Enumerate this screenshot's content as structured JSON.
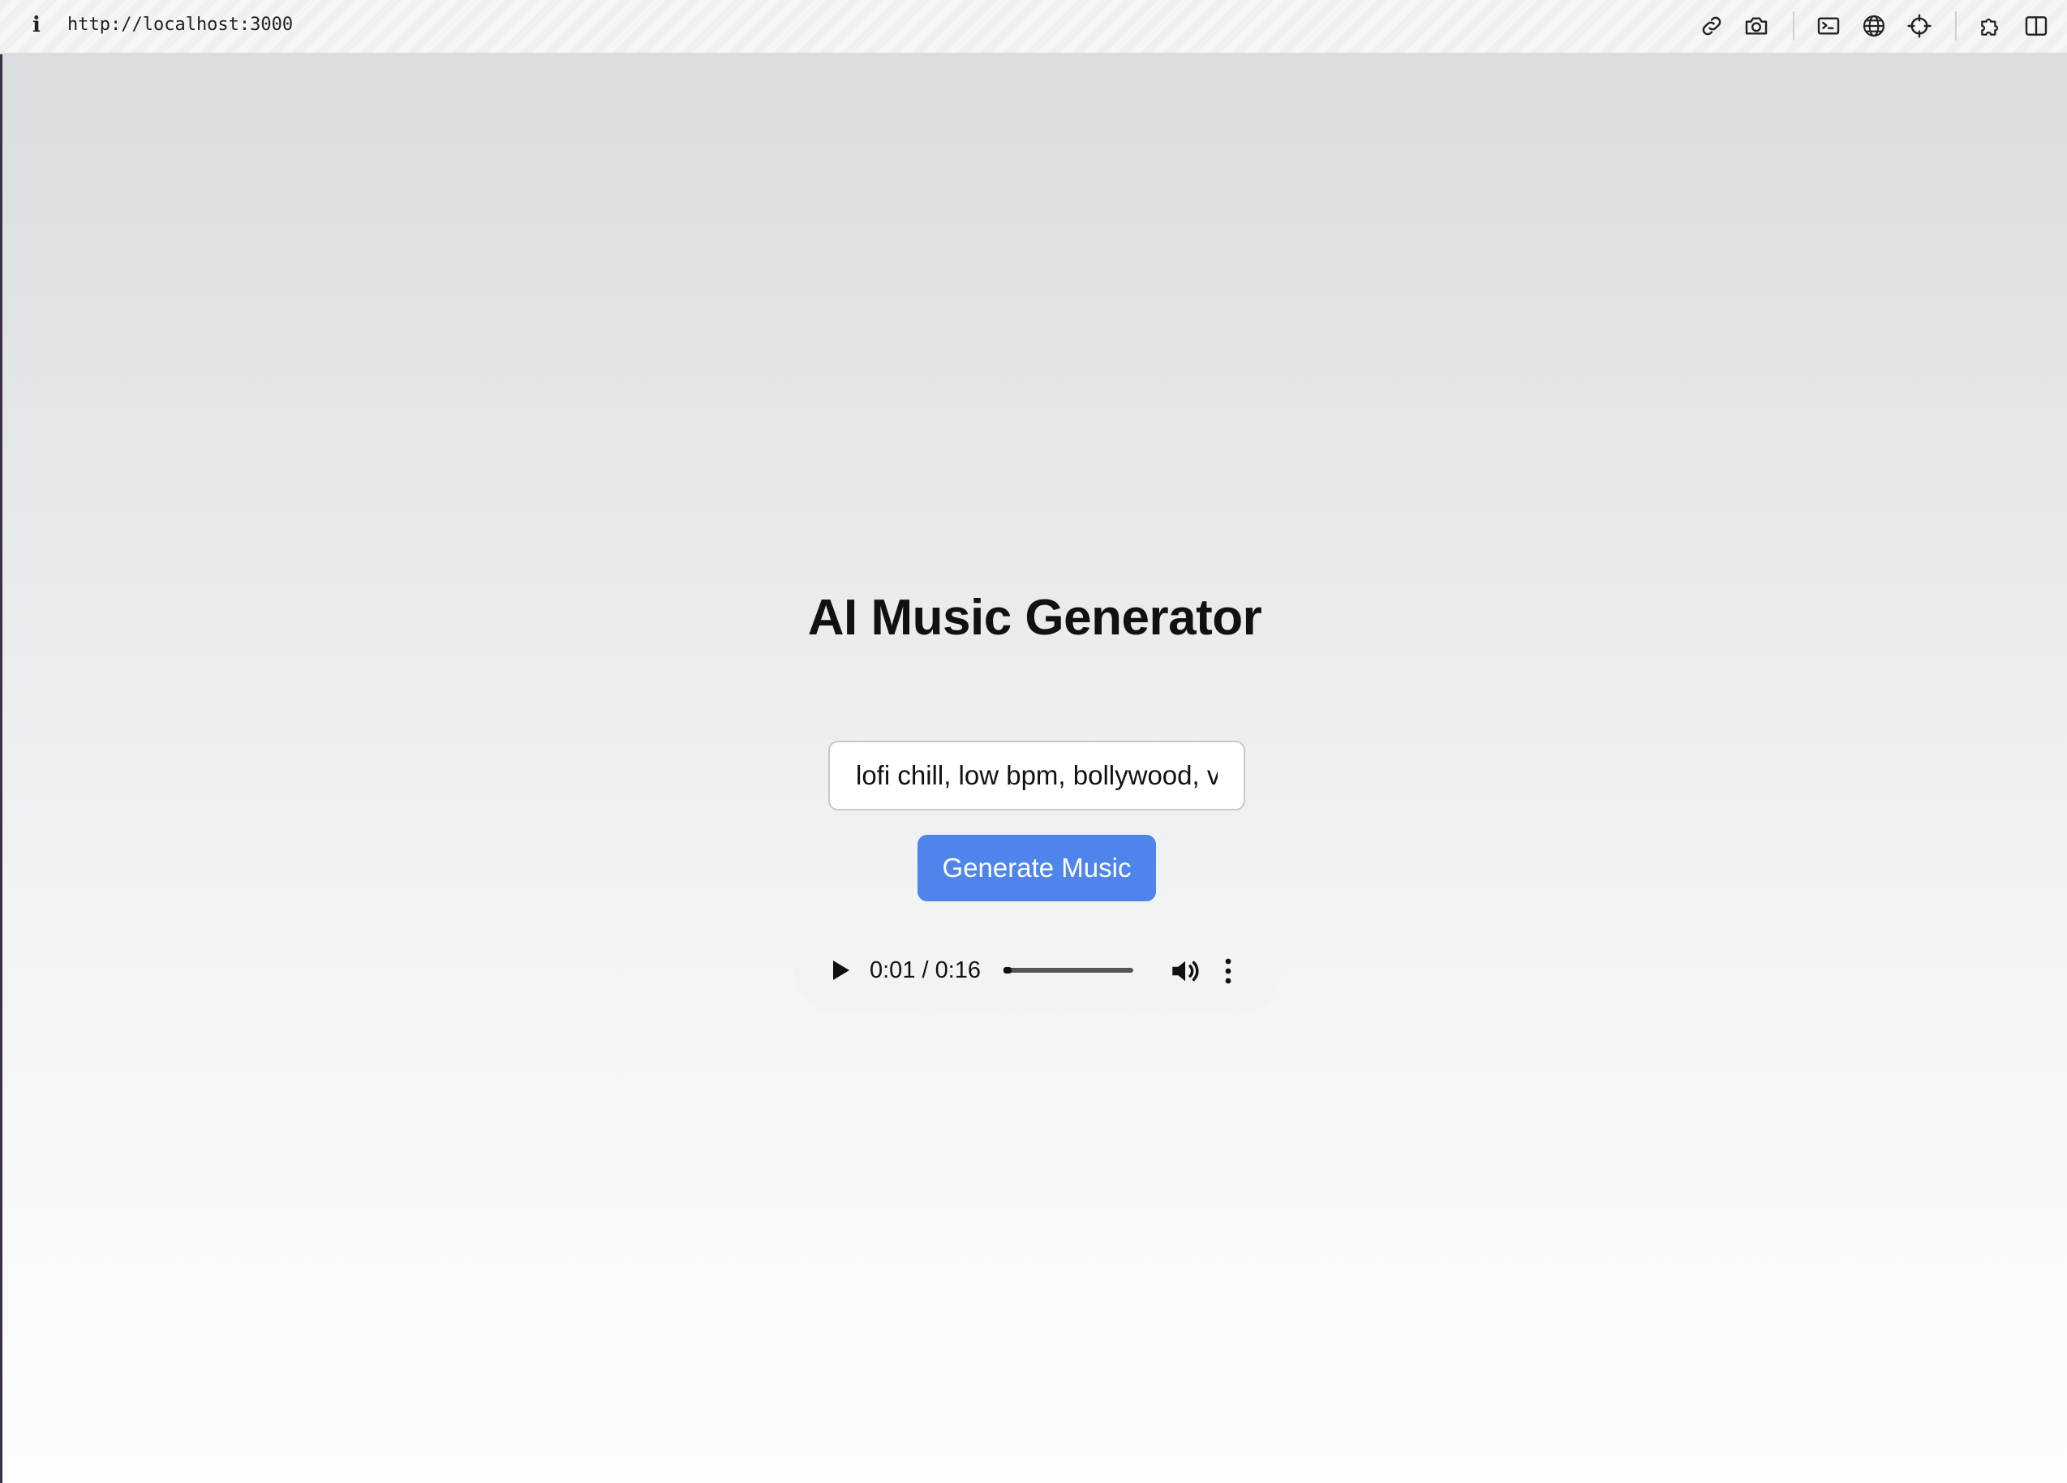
{
  "browser": {
    "url": "http://localhost:3000",
    "info_icon_glyph": "i",
    "toolbar_icons": [
      "link-icon",
      "camera-icon",
      "terminal-icon",
      "globe-icon",
      "crosshair-icon",
      "puzzle-icon",
      "split-view-icon"
    ]
  },
  "app": {
    "title": "AI Music Generator",
    "prompt_value": "lofi chill, low bpm, bollywood, v",
    "generate_label": "Generate Music",
    "button_color": "#4f85ea"
  },
  "player": {
    "time_display": "0:01 / 0:16",
    "current_seconds": 1,
    "duration_seconds": 16,
    "progress_fraction": 0.0625,
    "icons": [
      "play-icon",
      "volume-icon",
      "more-options-icon"
    ]
  }
}
